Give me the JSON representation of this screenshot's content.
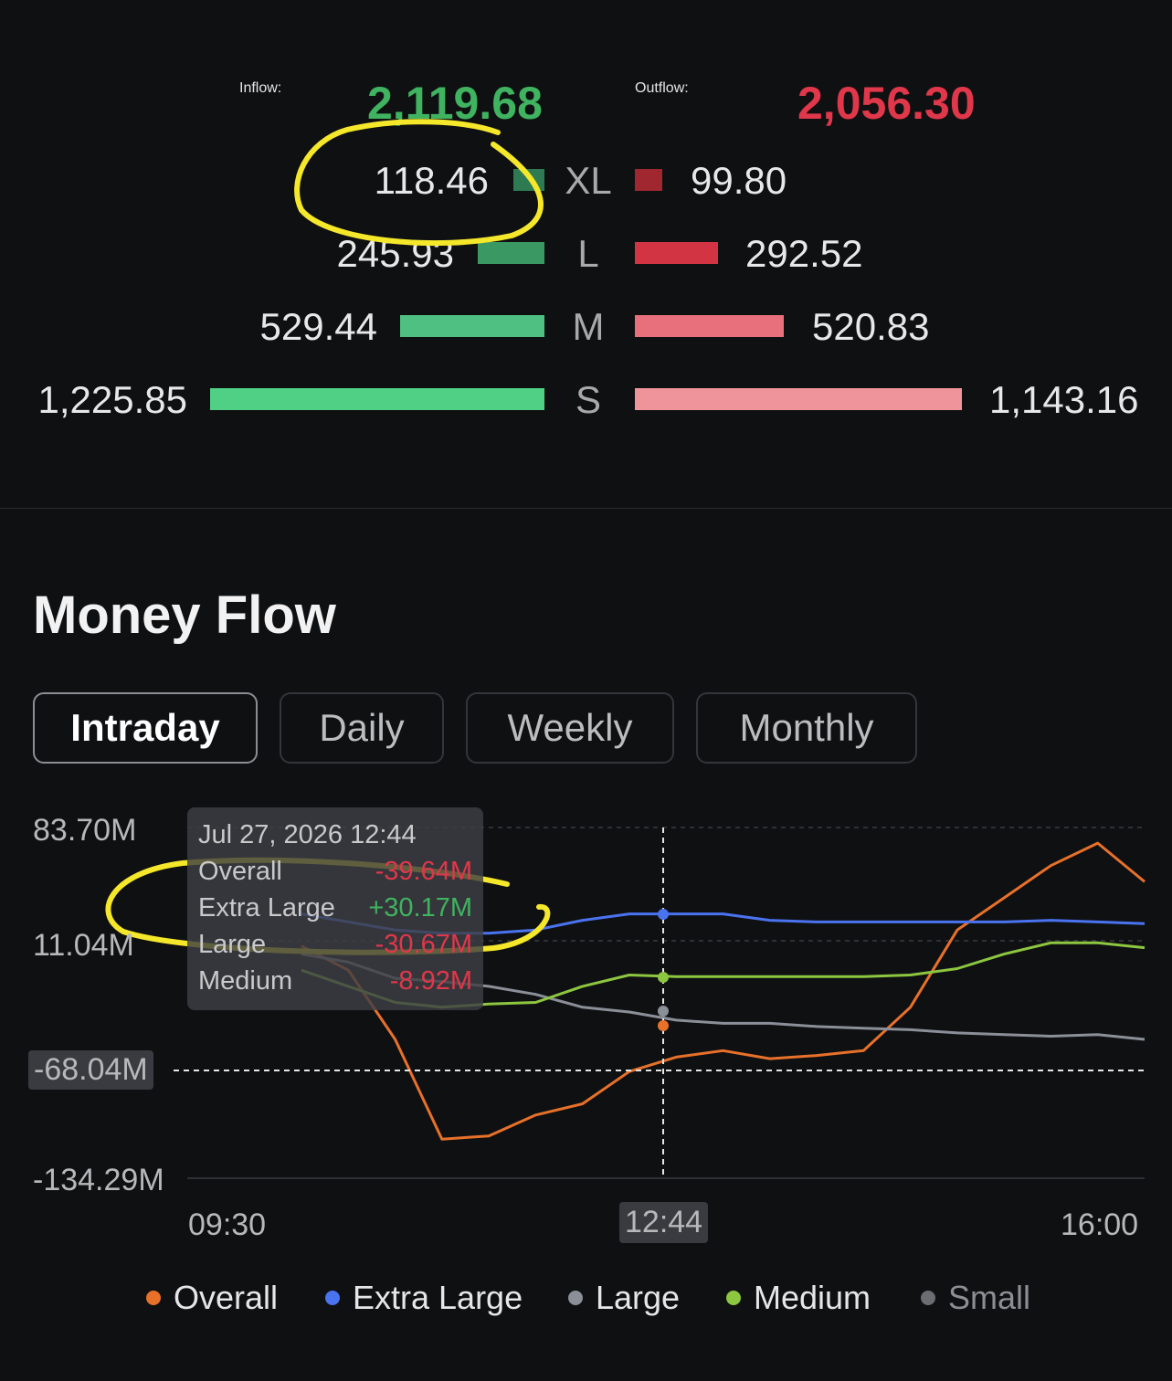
{
  "summary": {
    "inflow_label": "Inflow:",
    "inflow_value": "2,119.68",
    "outflow_label": "Outflow:",
    "outflow_value": "2,056.30",
    "rows": [
      {
        "cat": "XL",
        "in": "118.46",
        "out": "99.80"
      },
      {
        "cat": "L",
        "in": "245.93",
        "out": "292.52"
      },
      {
        "cat": "M",
        "in": "529.44",
        "out": "520.83"
      },
      {
        "cat": "S",
        "in": "1,225.85",
        "out": "1,143.16"
      }
    ]
  },
  "section_title": "Money Flow",
  "tabs": [
    {
      "label": "Intraday",
      "active": true
    },
    {
      "label": "Daily",
      "active": false
    },
    {
      "label": "Weekly",
      "active": false
    },
    {
      "label": "Monthly",
      "active": false
    }
  ],
  "tooltip": {
    "date": "Jul 27, 2026 12:44",
    "rows": [
      {
        "name": "Overall",
        "value": "-39.64M",
        "color": "#e0374a"
      },
      {
        "name": "Extra Large",
        "value": "+30.17M",
        "color": "#3fb35f"
      },
      {
        "name": "Large",
        "value": "-30.67M",
        "color": "#e0374a"
      },
      {
        "name": "Medium",
        "value": "-8.92M",
        "color": "#e0374a"
      }
    ]
  },
  "colors": {
    "inflow": "#3fb35f",
    "outflow": "#e0374a",
    "annotation": "#f5e72a"
  },
  "chart_data": {
    "type": "line",
    "y_tick_labels": [
      "83.70M",
      "11.04M",
      "-68.04M",
      "-134.29M"
    ],
    "x_tick_labels": [
      "09:30",
      "12:44",
      "16:00"
    ],
    "cursor_y_label": "-68.04M",
    "cursor_x_label": "12:44",
    "ylim": [
      -134.29,
      83.7
    ],
    "x": [
      "09:30",
      "10:00",
      "10:30",
      "11:00",
      "11:30",
      "12:00",
      "12:30",
      "12:44",
      "13:00",
      "13:30",
      "14:00",
      "14:30",
      "15:00",
      "15:30",
      "16:00"
    ],
    "series": [
      {
        "name": "Overall",
        "color": "#e8712a",
        "values": [
          10,
          -5,
          -48,
          -110,
          -108,
          -95,
          -88,
          -68,
          -59,
          -55,
          -60,
          -58,
          -55,
          -28,
          20,
          40,
          60,
          74,
          50
        ]
      },
      {
        "name": "Extra Large",
        "color": "#4a73f0",
        "values": [
          30,
          25,
          20,
          18,
          18,
          20,
          26,
          30,
          30,
          30,
          26,
          25,
          25,
          25,
          25,
          25,
          26,
          25,
          24
        ]
      },
      {
        "name": "Large",
        "color": "#8a8f98",
        "values": [
          5,
          0,
          -10,
          -12,
          -15,
          -20,
          -28,
          -31,
          -36,
          -38,
          -38,
          -40,
          -41,
          -42,
          -44,
          -45,
          -46,
          -45,
          -48
        ]
      },
      {
        "name": "Medium",
        "color": "#8dc63f",
        "values": [
          -5,
          -15,
          -25,
          -28,
          -26,
          -25,
          -15,
          -8,
          -9,
          -9,
          -9,
          -9,
          -9,
          -8,
          -4,
          5,
          12,
          12,
          9
        ]
      },
      {
        "name": "Small",
        "color": "#6b6d72",
        "values": []
      }
    ]
  }
}
